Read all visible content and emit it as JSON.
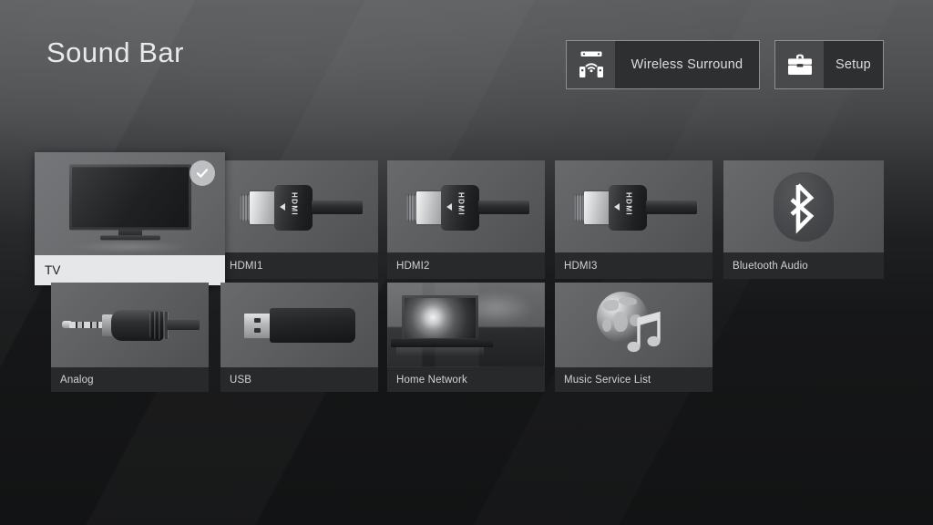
{
  "screen": {
    "device_name": "Sound Bar",
    "background_color": "#2e2f31"
  },
  "header": {
    "title": "Sound Bar",
    "buttons": [
      {
        "label": "Wireless Surround",
        "icon": "wireless-surround-icon"
      },
      {
        "label": "Setup",
        "icon": "toolbox-icon"
      }
    ]
  },
  "input_grid": {
    "selected_input": "TV",
    "selected_badge_icon": "check-circle-icon",
    "rows": [
      {
        "tiles": [
          {
            "label": "TV",
            "icon": "television-icon",
            "selected": true
          },
          {
            "label": "HDMI1",
            "icon": "hdmi-cable-icon",
            "selected": false
          },
          {
            "label": "HDMI2",
            "icon": "hdmi-cable-icon",
            "selected": false
          },
          {
            "label": "HDMI3",
            "icon": "hdmi-cable-icon",
            "selected": false
          },
          {
            "label": "Bluetooth Audio",
            "icon": "bluetooth-icon",
            "selected": false
          }
        ]
      },
      {
        "tiles": [
          {
            "label": "Analog",
            "icon": "analog-jack-icon",
            "selected": false
          },
          {
            "label": "USB",
            "icon": "usb-drive-icon",
            "selected": false
          },
          {
            "label": "Home Network",
            "icon": "home-network-icon",
            "selected": false
          },
          {
            "label": "Music Service List",
            "icon": "globe-music-icon",
            "selected": false
          }
        ]
      }
    ]
  }
}
